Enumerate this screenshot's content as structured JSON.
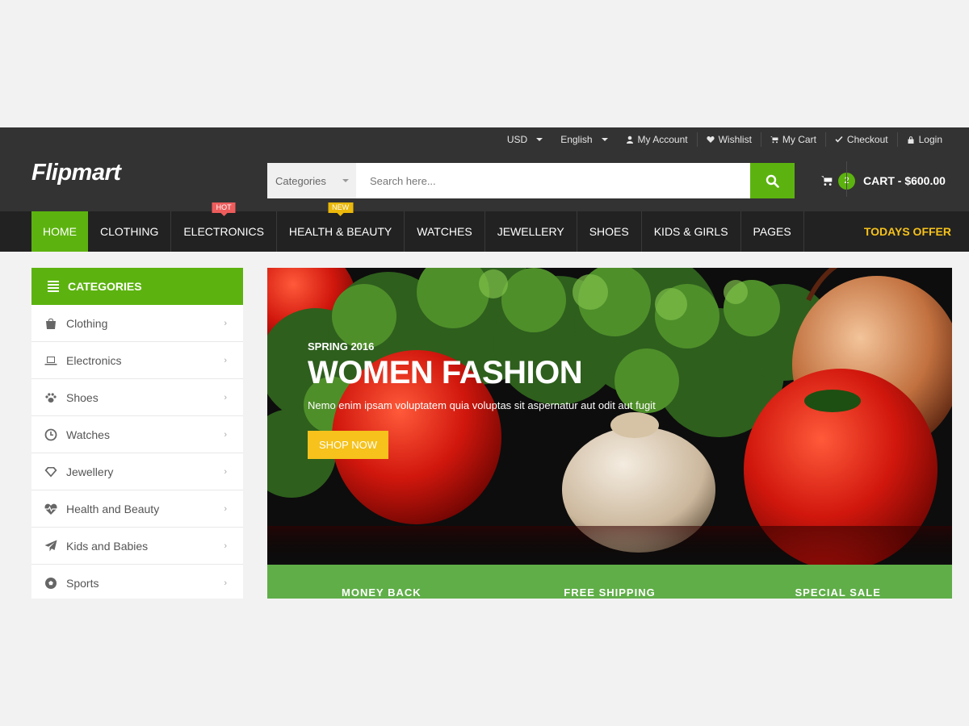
{
  "brand": {
    "logo": "Flipmart",
    "accent": "#5cb30f",
    "offer_color": "#f6c21b"
  },
  "topbar": {
    "currency": "USD",
    "language": "English",
    "links": [
      {
        "label": "My Account",
        "icon": "user-icon"
      },
      {
        "label": "Wishlist",
        "icon": "heart-icon"
      },
      {
        "label": "My Cart",
        "icon": "cart-icon"
      },
      {
        "label": "Checkout",
        "icon": "check-icon"
      },
      {
        "label": "Login",
        "icon": "lock-icon"
      }
    ]
  },
  "search": {
    "category_label": "Categories",
    "placeholder": "Search here..."
  },
  "cart": {
    "count": "2",
    "label": "CART - $600.00"
  },
  "nav": {
    "items": [
      {
        "label": "HOME"
      },
      {
        "label": "CLOTHING"
      },
      {
        "label": "ELECTRONICS",
        "tag": "HOT"
      },
      {
        "label": "HEALTH & BEAUTY",
        "tag": "NEW"
      },
      {
        "label": "WATCHES"
      },
      {
        "label": "JEWELLERY"
      },
      {
        "label": "SHOES"
      },
      {
        "label": "KIDS & GIRLS"
      },
      {
        "label": "PAGES"
      }
    ],
    "offer": "TODAYS OFFER"
  },
  "sidebar": {
    "title": "CATEGORIES",
    "items": [
      {
        "label": "Clothing",
        "icon": "shopping-bag-icon"
      },
      {
        "label": "Electronics",
        "icon": "laptop-icon"
      },
      {
        "label": "Shoes",
        "icon": "paw-icon"
      },
      {
        "label": "Watches",
        "icon": "clock-icon"
      },
      {
        "label": "Jewellery",
        "icon": "diamond-icon"
      },
      {
        "label": "Health and Beauty",
        "icon": "heartbeat-icon"
      },
      {
        "label": "Kids and Babies",
        "icon": "paper-plane-icon"
      },
      {
        "label": "Sports",
        "icon": "soccer-ball-icon"
      }
    ]
  },
  "banner": {
    "season": "SPRING 2016",
    "title": "WOMEN FASHION",
    "description": "Nemo enim ipsam voluptatem quia voluptas sit aspernatur aut odit aut fugit",
    "button": "SHOP NOW"
  },
  "info_bar": {
    "items": [
      "MONEY BACK",
      "FREE SHIPPING",
      "SPECIAL SALE"
    ]
  }
}
